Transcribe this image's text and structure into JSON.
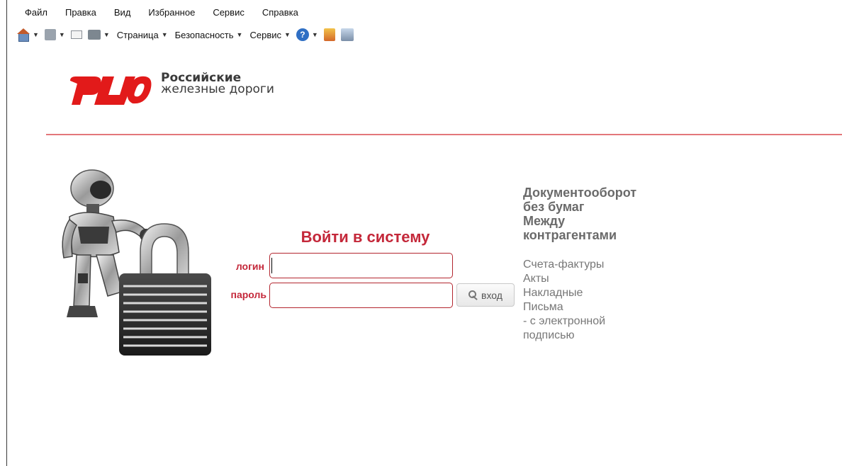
{
  "browser": {
    "menu": [
      "Файл",
      "Правка",
      "Вид",
      "Избранное",
      "Сервис",
      "Справка"
    ],
    "toolbar": {
      "page_label": "Страница",
      "security_label": "Безопасность",
      "service_label": "Сервис"
    }
  },
  "logo": {
    "line1": "Российские",
    "line2": "железные дороги"
  },
  "login": {
    "title": "Войти в систему",
    "login_label": "логин",
    "password_label": "пароль",
    "login_value": "",
    "password_value": "",
    "enter_button": "вход"
  },
  "promo": {
    "headline": [
      "Документооборот",
      "без бумаг",
      "Между",
      "контрагентами"
    ],
    "items": [
      "Счета-фактуры",
      "Акты",
      "Накладные",
      "Письма",
      "- с электронной",
      "подписью"
    ]
  },
  "colors": {
    "brand_red": "#e21a1a",
    "login_red": "#c4283a",
    "divider": "#e3777a"
  }
}
